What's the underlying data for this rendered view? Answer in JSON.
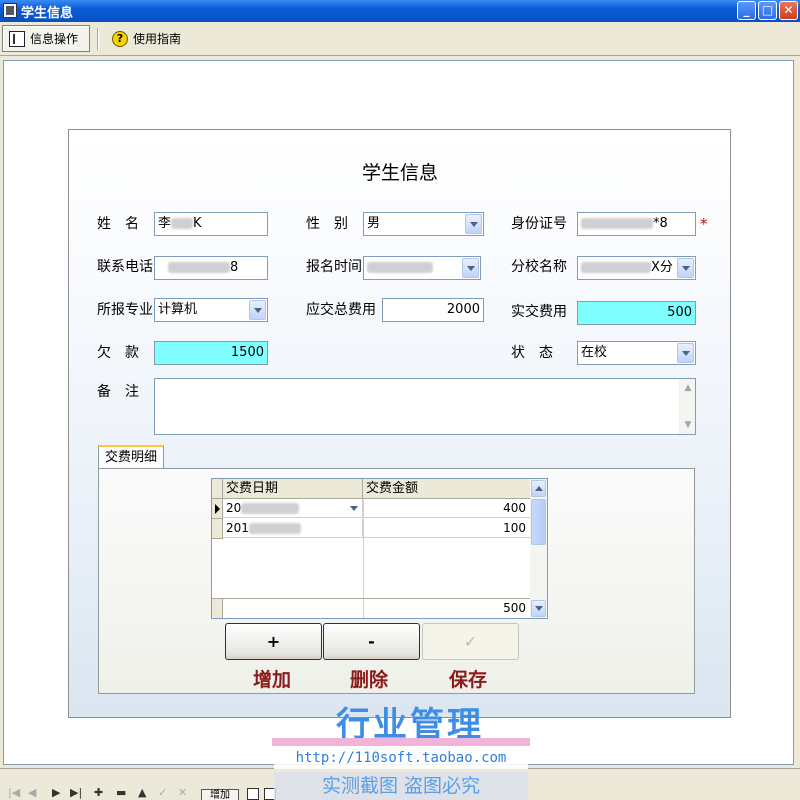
{
  "window": {
    "title": "学生信息",
    "min_glyph": "_",
    "max_glyph": "□",
    "close_glyph": "✕"
  },
  "toolbar": {
    "info_ops": "信息操作",
    "guide": "使用指南",
    "help_glyph": "?"
  },
  "form": {
    "title": "学生信息",
    "name_label": "姓　名",
    "name_prefix": "李",
    "name_suffix": "K",
    "gender_label": "性　别",
    "gender_value": "男",
    "idcard_label": "身份证号",
    "idcard_suffix": "*8",
    "required_mark": "*",
    "phone_label": "联系电话",
    "phone_suffix": "8",
    "signup_label": "报名时间",
    "branch_label": "分校名称",
    "branch_suffix": "X分",
    "major_label": "所报专业",
    "major_value": "计算机",
    "total_fee_label": "应交总费用",
    "total_fee_value": "2000",
    "paid_label": "实交费用",
    "paid_value": "500",
    "owed_label": "欠　款",
    "owed_value": "1500",
    "status_label": "状　态",
    "status_value": "在校",
    "remark_label": "备　注"
  },
  "payments": {
    "tab_label": "交费明细",
    "col_date": "交费日期",
    "col_amount": "交费金额",
    "rows": [
      {
        "date_prefix": "20",
        "amount": "400"
      },
      {
        "date_prefix": "201",
        "amount": "100"
      }
    ],
    "total": "500"
  },
  "actions": {
    "add_symbol": "+",
    "delete_symbol": "-",
    "save_symbol": "✓",
    "add_label": "增加",
    "delete_label": "删除",
    "save_label": "保存"
  },
  "watermark": {
    "title": "行业管理",
    "url": "http://110soft.taobao.com",
    "note": "实测截图 盗图必究"
  },
  "navigator": {
    "add_label": "增加"
  }
}
